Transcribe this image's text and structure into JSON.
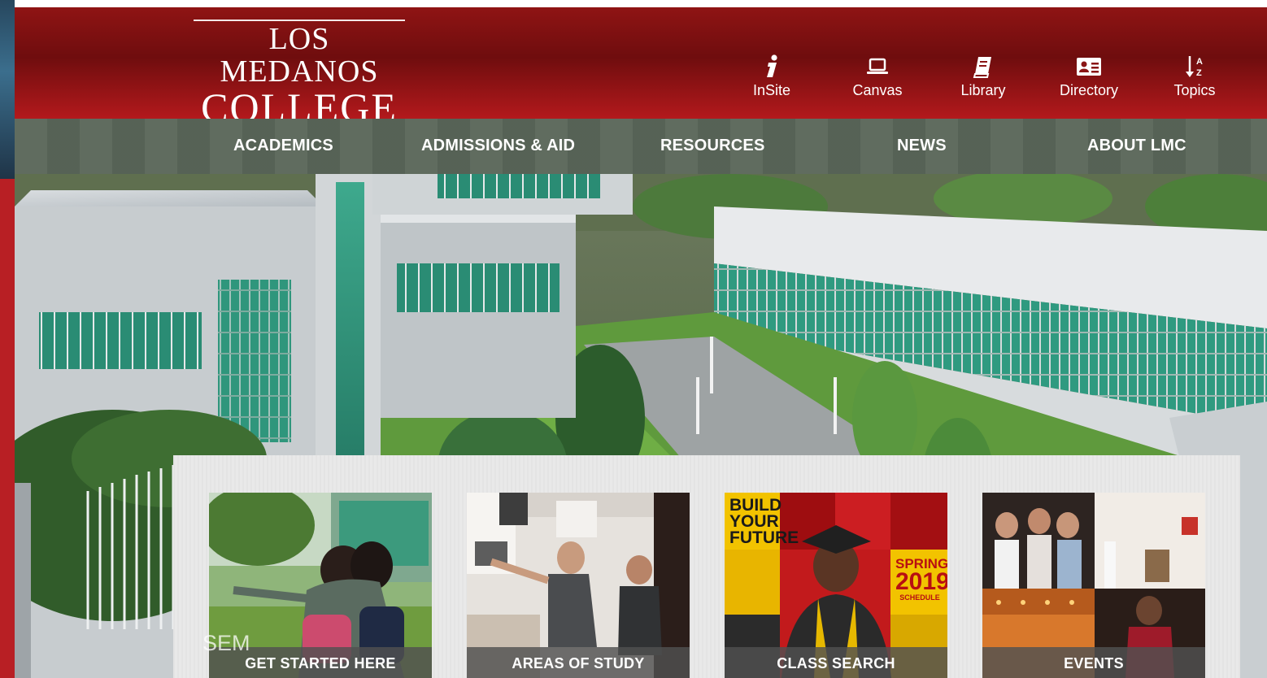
{
  "header": {
    "logo": {
      "line1": "LOS MEDANOS",
      "line2": "COLLEGE"
    },
    "quicklinks": [
      {
        "label": "InSite",
        "icon": "info-icon"
      },
      {
        "label": "Canvas",
        "icon": "laptop-icon"
      },
      {
        "label": "Library",
        "icon": "book-icon"
      },
      {
        "label": "Directory",
        "icon": "address-card-icon"
      },
      {
        "label": "Topics",
        "icon": "sort-az-icon"
      }
    ]
  },
  "nav": {
    "items": [
      "ACADEMICS",
      "ADMISSIONS & AID",
      "RESOURCES",
      "NEWS",
      "ABOUT LMC"
    ]
  },
  "hero": {
    "overlay_text": "SEM"
  },
  "cards": [
    {
      "label": "GET STARTED HERE"
    },
    {
      "label": "AREAS OF STUDY"
    },
    {
      "label": "CLASS SEARCH",
      "poster_line1": "BUILD",
      "poster_line2": "YOUR",
      "poster_line3": "FUTURE",
      "season": "SPRING",
      "year": "2019",
      "schedule": "SCHEDULE"
    },
    {
      "label": "EVENTS"
    }
  ],
  "colors": {
    "brand_red": "#8f1414",
    "header_bottom": "#b3191c",
    "nav_overlay": "#1c2c1a",
    "panel_bg": "#e9e9e9",
    "card_label_bg": "#505050",
    "poster_yellow": "#f2c300"
  }
}
